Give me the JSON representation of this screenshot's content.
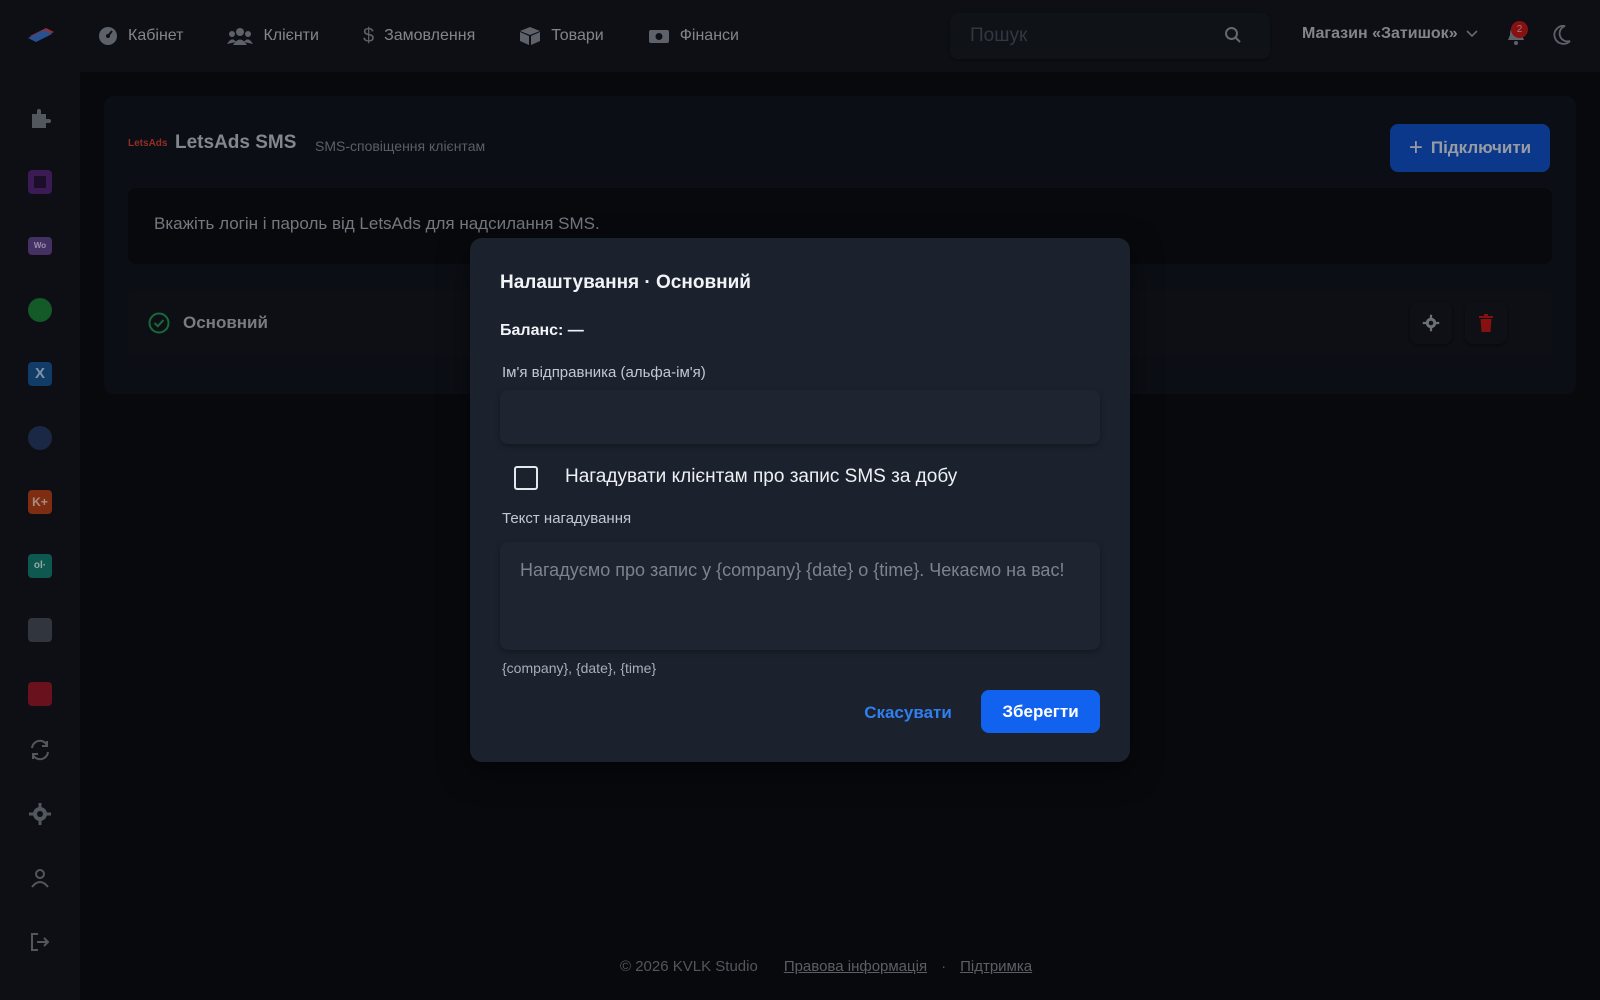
{
  "nav": {
    "items": [
      {
        "label": "Кабінет",
        "icon": "dashboard-icon"
      },
      {
        "label": "Клієнти",
        "icon": "users-icon"
      },
      {
        "label": "Замовлення",
        "icon": "dollar-icon"
      },
      {
        "label": "Товари",
        "icon": "box-icon"
      },
      {
        "label": "Фінанси",
        "icon": "money-icon"
      }
    ],
    "search_placeholder": "Пошук",
    "store_name": "Магазин «Затишок»",
    "notification_count": "2"
  },
  "card": {
    "logo_text_a": "Lets",
    "logo_text_b": "Ads",
    "title": "LetsAds SMS",
    "subtitle": "SMS-сповіщення клієнтам",
    "connect_label": "Підключити",
    "info_text": "Вкажіть логін і пароль від LetsAds для надсилання SMS.",
    "account_name": "Основний"
  },
  "modal": {
    "title": "Налаштування · Основний",
    "balance": "Баланс: —",
    "sender_label": "Ім'я відправника (альфа-ім'я)",
    "sender_value": "",
    "reminder_label": "Нагадувати клієнтам про запис SMS за добу",
    "reminder_checked": false,
    "text_label": "Текст нагадування",
    "text_placeholder": "Нагадуємо про запис у {company} {date} о {time}. Чекаємо на вас!",
    "hint": "{company}, {date}, {time}",
    "cancel_label": "Скасувати",
    "save_label": "Зберегти"
  },
  "footer": {
    "copyright": "© 2026 KVLK Studio",
    "legal": "Правова інформація",
    "separator": "·",
    "support": "Підтримка"
  },
  "colors": {
    "accent": "#1262f0",
    "danger": "#d01b1b",
    "success": "#22a35a"
  }
}
